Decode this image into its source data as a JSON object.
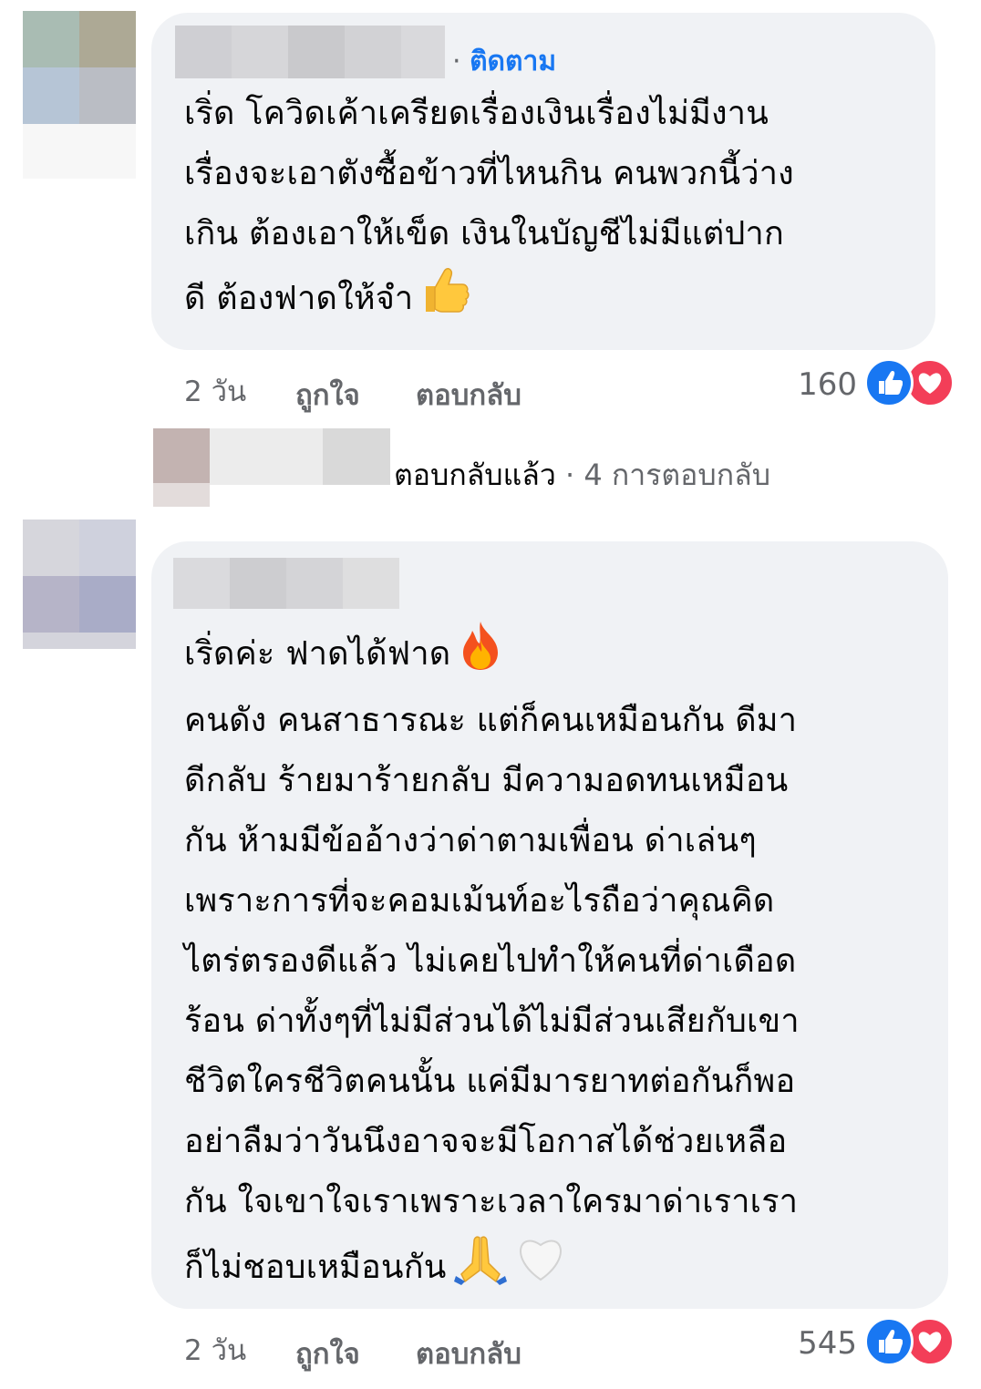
{
  "comment1": {
    "follow_label": "ติดตาม",
    "lines": [
      "เริ่ด โควิดเค้าเครียดเรื่องเงินเรื่องไม่มีงาน",
      "เรื่องจะเอาตังซื้อข้าวที่ไหนกิน คนพวกนี้ว่าง",
      "เกิน ต้องเอาให้เข็ด เงินในบัญชีไม่มีแต่ปาก",
      "ดี ต้องฟาดให้จำ"
    ],
    "end_emoji": "thumbs-up",
    "time": "2 วัน",
    "like_action": "ถูกใจ",
    "reply_action": "ตอบกลับ",
    "reaction_count": "160"
  },
  "replies_row": {
    "replied_label": "ตอบกลับแล้ว",
    "separator": " · ",
    "count_label": "4 การตอบกลับ"
  },
  "comment2": {
    "first_line": "เริ่ดค่ะ ฟาดได้ฟาด",
    "first_emoji": "fire",
    "lines": [
      "คนดัง คนสาธารณะ แต่ก็คนเหมือนกัน ดีมา",
      "ดีกลับ ร้ายมาร้ายกลับ มีความอดทนเหมือน",
      "กัน ห้ามมีข้ออ้างว่าด่าตามเพื่อน ด่าเล่นๆ",
      "เพราะการที่จะคอมเม้นท์อะไรถือว่าคุณคิด",
      "ไตร่ตรองดีแล้ว ไม่เคยไปทำให้คนที่ด่าเดือด",
      "ร้อน ด่าทั้งๆที่ไม่มีส่วนได้ไม่มีส่วนเสียกับเขา",
      "ชีวิตใครชีวิตคนนั้น แค่มีมารยาทต่อกันก็พอ",
      "อย่าลืมว่าวันนึงอาจจะมีโอกาสได้ช่วยเหลือ",
      "กัน ใจเขาใจเราเพราะเวลาใครมาด่าเราเรา",
      "ก็ไม่ชอบเหมือนกัน"
    ],
    "end_emojis": [
      "folded-hands",
      "white-heart"
    ],
    "time": "2 วัน",
    "like_action": "ถูกใจ",
    "reply_action": "ตอบกลับ",
    "reaction_count": "545"
  },
  "colors": {
    "bubble": "#f0f2f5",
    "link_blue": "#1877f2",
    "meta_gray": "#65676b",
    "like_blue": "#1877f2",
    "love_red": "#f33e58"
  }
}
